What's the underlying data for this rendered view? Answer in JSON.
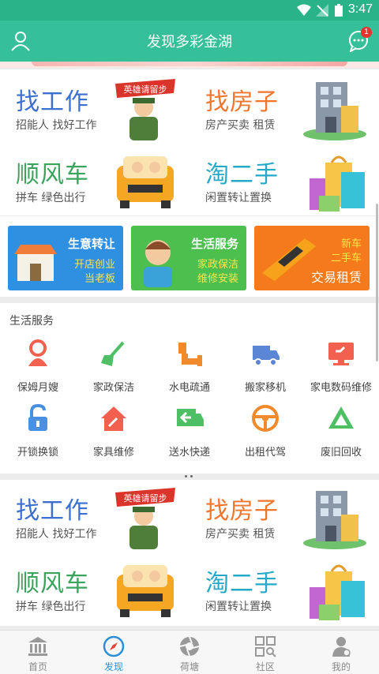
{
  "status": {
    "time": "3:47"
  },
  "header": {
    "title": "发现多彩金湖",
    "badge": "1"
  },
  "grid_sections": [
    {
      "tiles": [
        {
          "title": "找工作",
          "subtitle": "招能人 找好工作",
          "art_label": "英雄请留步"
        },
        {
          "title": "找房子",
          "subtitle": "房产买卖 租赁"
        },
        {
          "title": "顺风车",
          "subtitle": "拼车 绿色出行"
        },
        {
          "title": "淘二手",
          "subtitle": "闲置转让置换"
        }
      ]
    },
    {
      "tiles": [
        {
          "title": "找工作",
          "subtitle": "招能人 找好工作",
          "art_label": "英雄请留步"
        },
        {
          "title": "找房子",
          "subtitle": "房产买卖 租赁"
        },
        {
          "title": "顺风车",
          "subtitle": "拼车 绿色出行"
        },
        {
          "title": "淘二手",
          "subtitle": "闲置转让置换"
        }
      ]
    }
  ],
  "promos": [
    {
      "title": "生意转让",
      "line1": "开店创业",
      "line2": "当老板",
      "bg": "#2f8fe0"
    },
    {
      "title": "生活服务",
      "line1": "家政保洁",
      "line2": "维修安装",
      "bg": "#4cbf4f"
    },
    {
      "title": "新车",
      "line1": "二手车",
      "line2": "交易租赁",
      "bg": "#f47a1c"
    }
  ],
  "services": {
    "heading": "生活服务",
    "items": [
      {
        "label": "保姆月嫂",
        "icon": "nanny-icon",
        "color": "#f2614f"
      },
      {
        "label": "家政保洁",
        "icon": "broom-icon",
        "color": "#4fbf65"
      },
      {
        "label": "水电疏通",
        "icon": "pipe-icon",
        "color": "#f08a2a"
      },
      {
        "label": "搬家移机",
        "icon": "truck-icon",
        "color": "#5b86d6"
      },
      {
        "label": "家电数码维修",
        "icon": "monitor-repair-icon",
        "color": "#f2614f"
      },
      {
        "label": "开锁换锁",
        "icon": "unlock-icon",
        "color": "#4a90e2"
      },
      {
        "label": "家具维修",
        "icon": "house-repair-icon",
        "color": "#f2614f"
      },
      {
        "label": "送水快递",
        "icon": "delivery-truck-icon",
        "color": "#4fbf65"
      },
      {
        "label": "出租代驾",
        "icon": "steering-wheel-icon",
        "color": "#f08a2a"
      },
      {
        "label": "废旧回收",
        "icon": "recycle-icon",
        "color": "#4fbf65"
      }
    ]
  },
  "tabs": [
    {
      "label": "首页",
      "icon": "bank-icon"
    },
    {
      "label": "发现",
      "icon": "compass-icon",
      "active": true
    },
    {
      "label": "荷塘",
      "icon": "aperture-icon"
    },
    {
      "label": "社区",
      "icon": "grid-search-icon"
    },
    {
      "label": "我的",
      "icon": "user-icon"
    }
  ]
}
